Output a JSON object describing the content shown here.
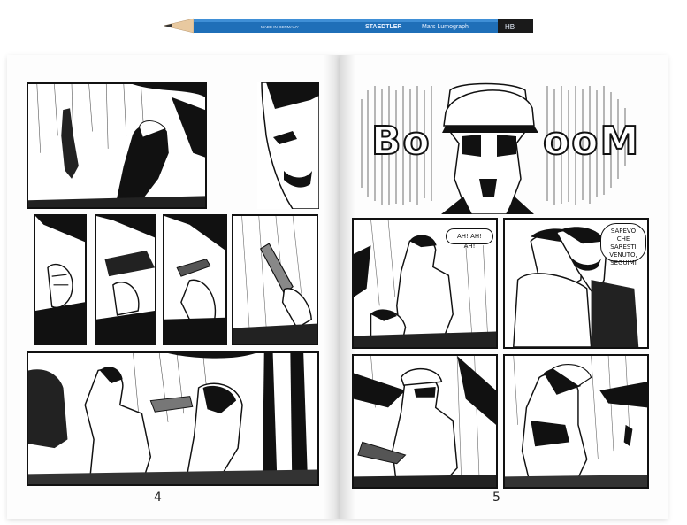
{
  "pencil": {
    "made_in": "MADE IN GERMANY",
    "brand": "STAEDTLER",
    "model": "Mars Lumograph",
    "grade": "HB"
  },
  "left_page": {
    "number": "4"
  },
  "right_page": {
    "number": "5",
    "sfx_left": "Bo",
    "sfx_right": "ooM",
    "speech_laugh": "AH! AH! AH!",
    "speech_line1": "SAPEVO CHE",
    "speech_line2": "SARESTI",
    "speech_line3": "VENUTO,",
    "speech_line4": "SEGUIMI"
  },
  "colors": {
    "ink": "#111111",
    "paper": "#fdfdfd",
    "pencil_blue": "#1f6fb8"
  }
}
